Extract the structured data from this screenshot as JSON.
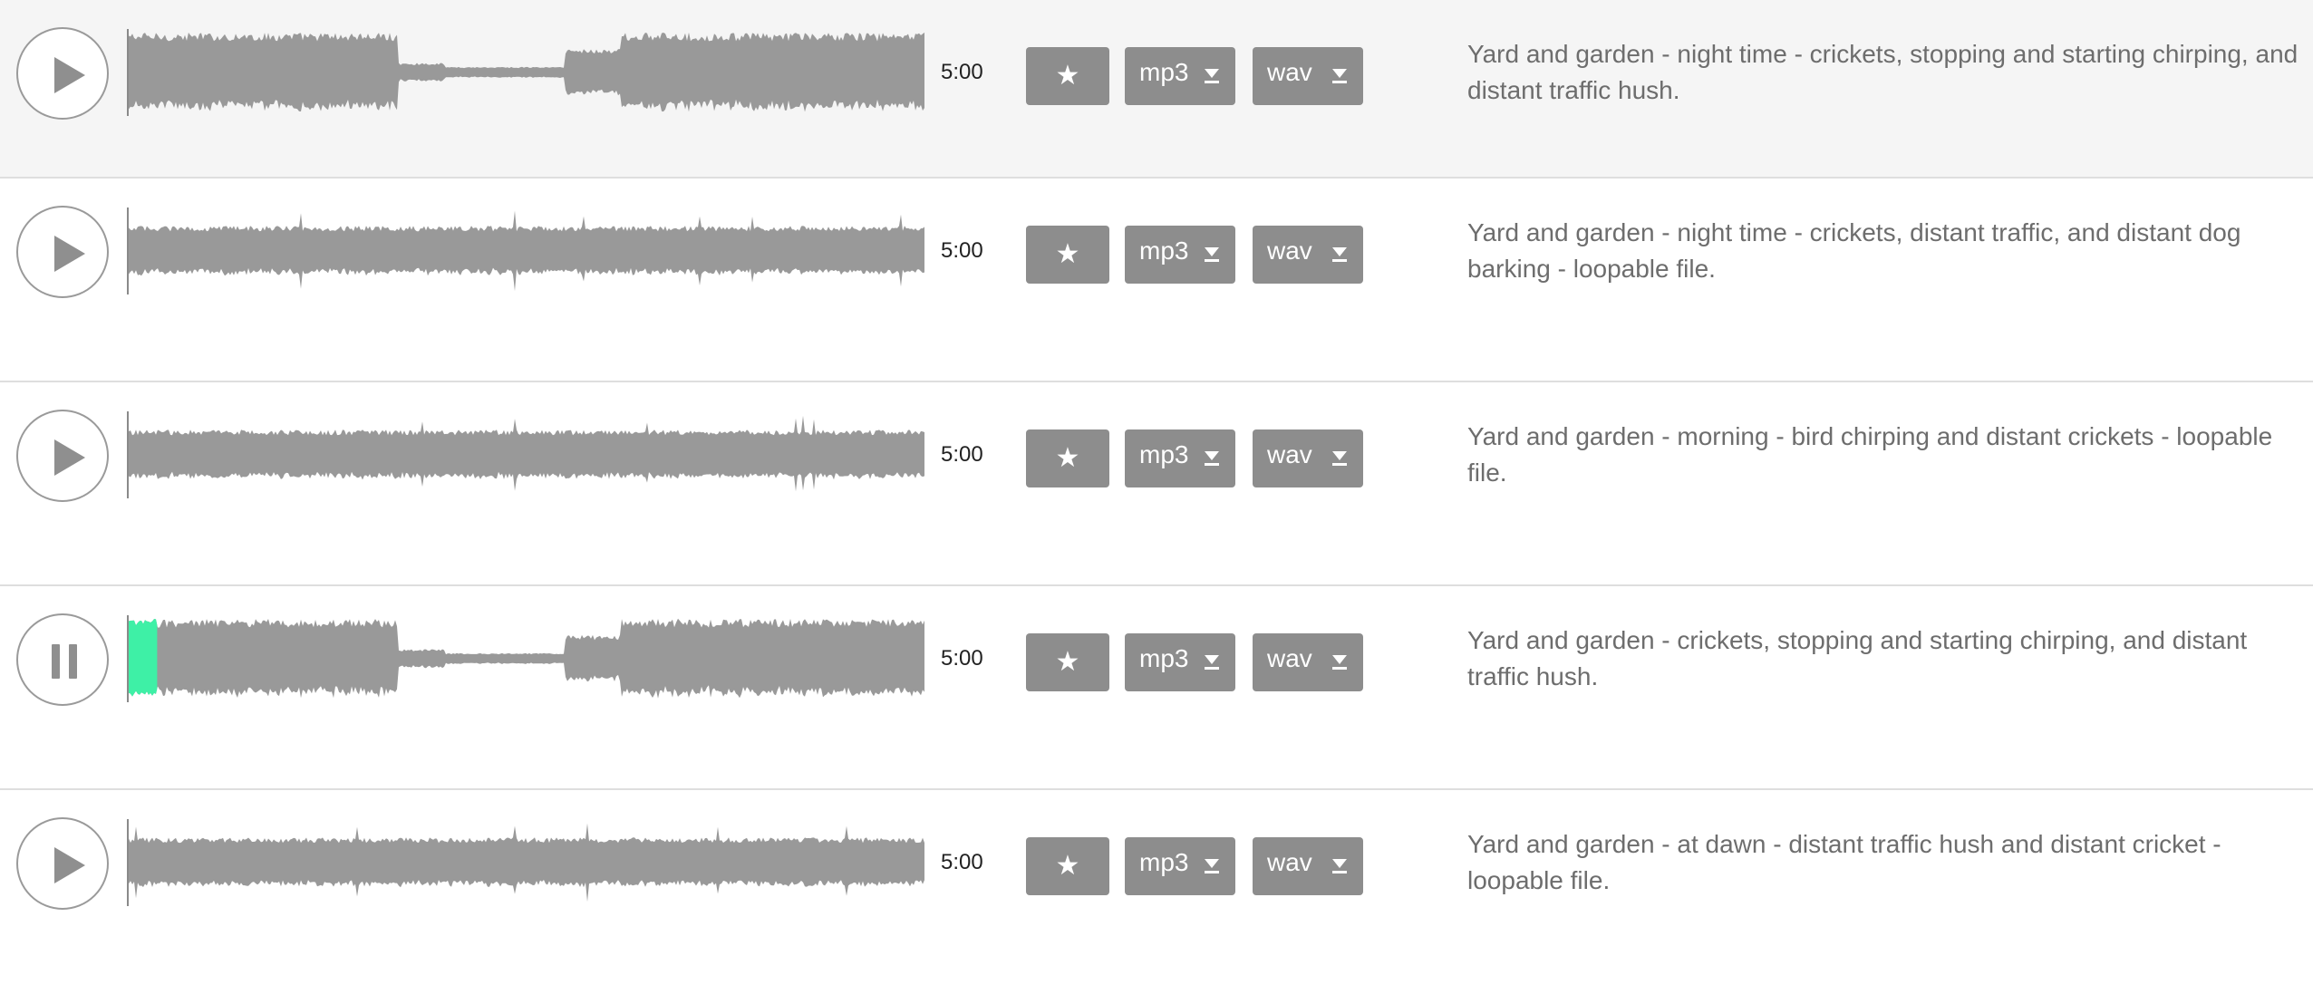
{
  "colors": {
    "waveform": "#999999",
    "progress": "#3ef0a6",
    "button": "#8d8d8d"
  },
  "icons": {
    "play": "play-icon",
    "pause": "pause-icon",
    "favorite": "star-icon",
    "download": "download-arrow-icon"
  },
  "tracks": [
    {
      "state": "stopped",
      "duration": "5:00",
      "favorite_glyph": "★",
      "mp3_label": "mp3",
      "wav_label": "wav",
      "description": "Yard and garden - night time - crickets, stopping and starting chirping, and distant traffic hush.",
      "progress": 0
    },
    {
      "state": "stopped",
      "duration": "5:00",
      "favorite_glyph": "★",
      "mp3_label": "mp3",
      "wav_label": "wav",
      "description": "Yard and garden - night time - crickets, distant traffic, and distant dog barking - loopable file.",
      "progress": 0
    },
    {
      "state": "stopped",
      "duration": "5:00",
      "favorite_glyph": "★",
      "mp3_label": "mp3",
      "wav_label": "wav",
      "description": "Yard and garden - morning - bird chirping and distant crickets - loopable file.",
      "progress": 0
    },
    {
      "state": "playing",
      "duration": "5:00",
      "favorite_glyph": "★",
      "mp3_label": "mp3",
      "wav_label": "wav",
      "description": "Yard and garden - crickets, stopping and starting chirping, and distant traffic hush.",
      "progress": 0.038
    },
    {
      "state": "stopped",
      "duration": "5:00",
      "favorite_glyph": "★",
      "mp3_label": "mp3",
      "wav_label": "wav",
      "description": "Yard and garden - at dawn - distant traffic hush and distant cricket - loopable file.",
      "progress": 0
    }
  ]
}
